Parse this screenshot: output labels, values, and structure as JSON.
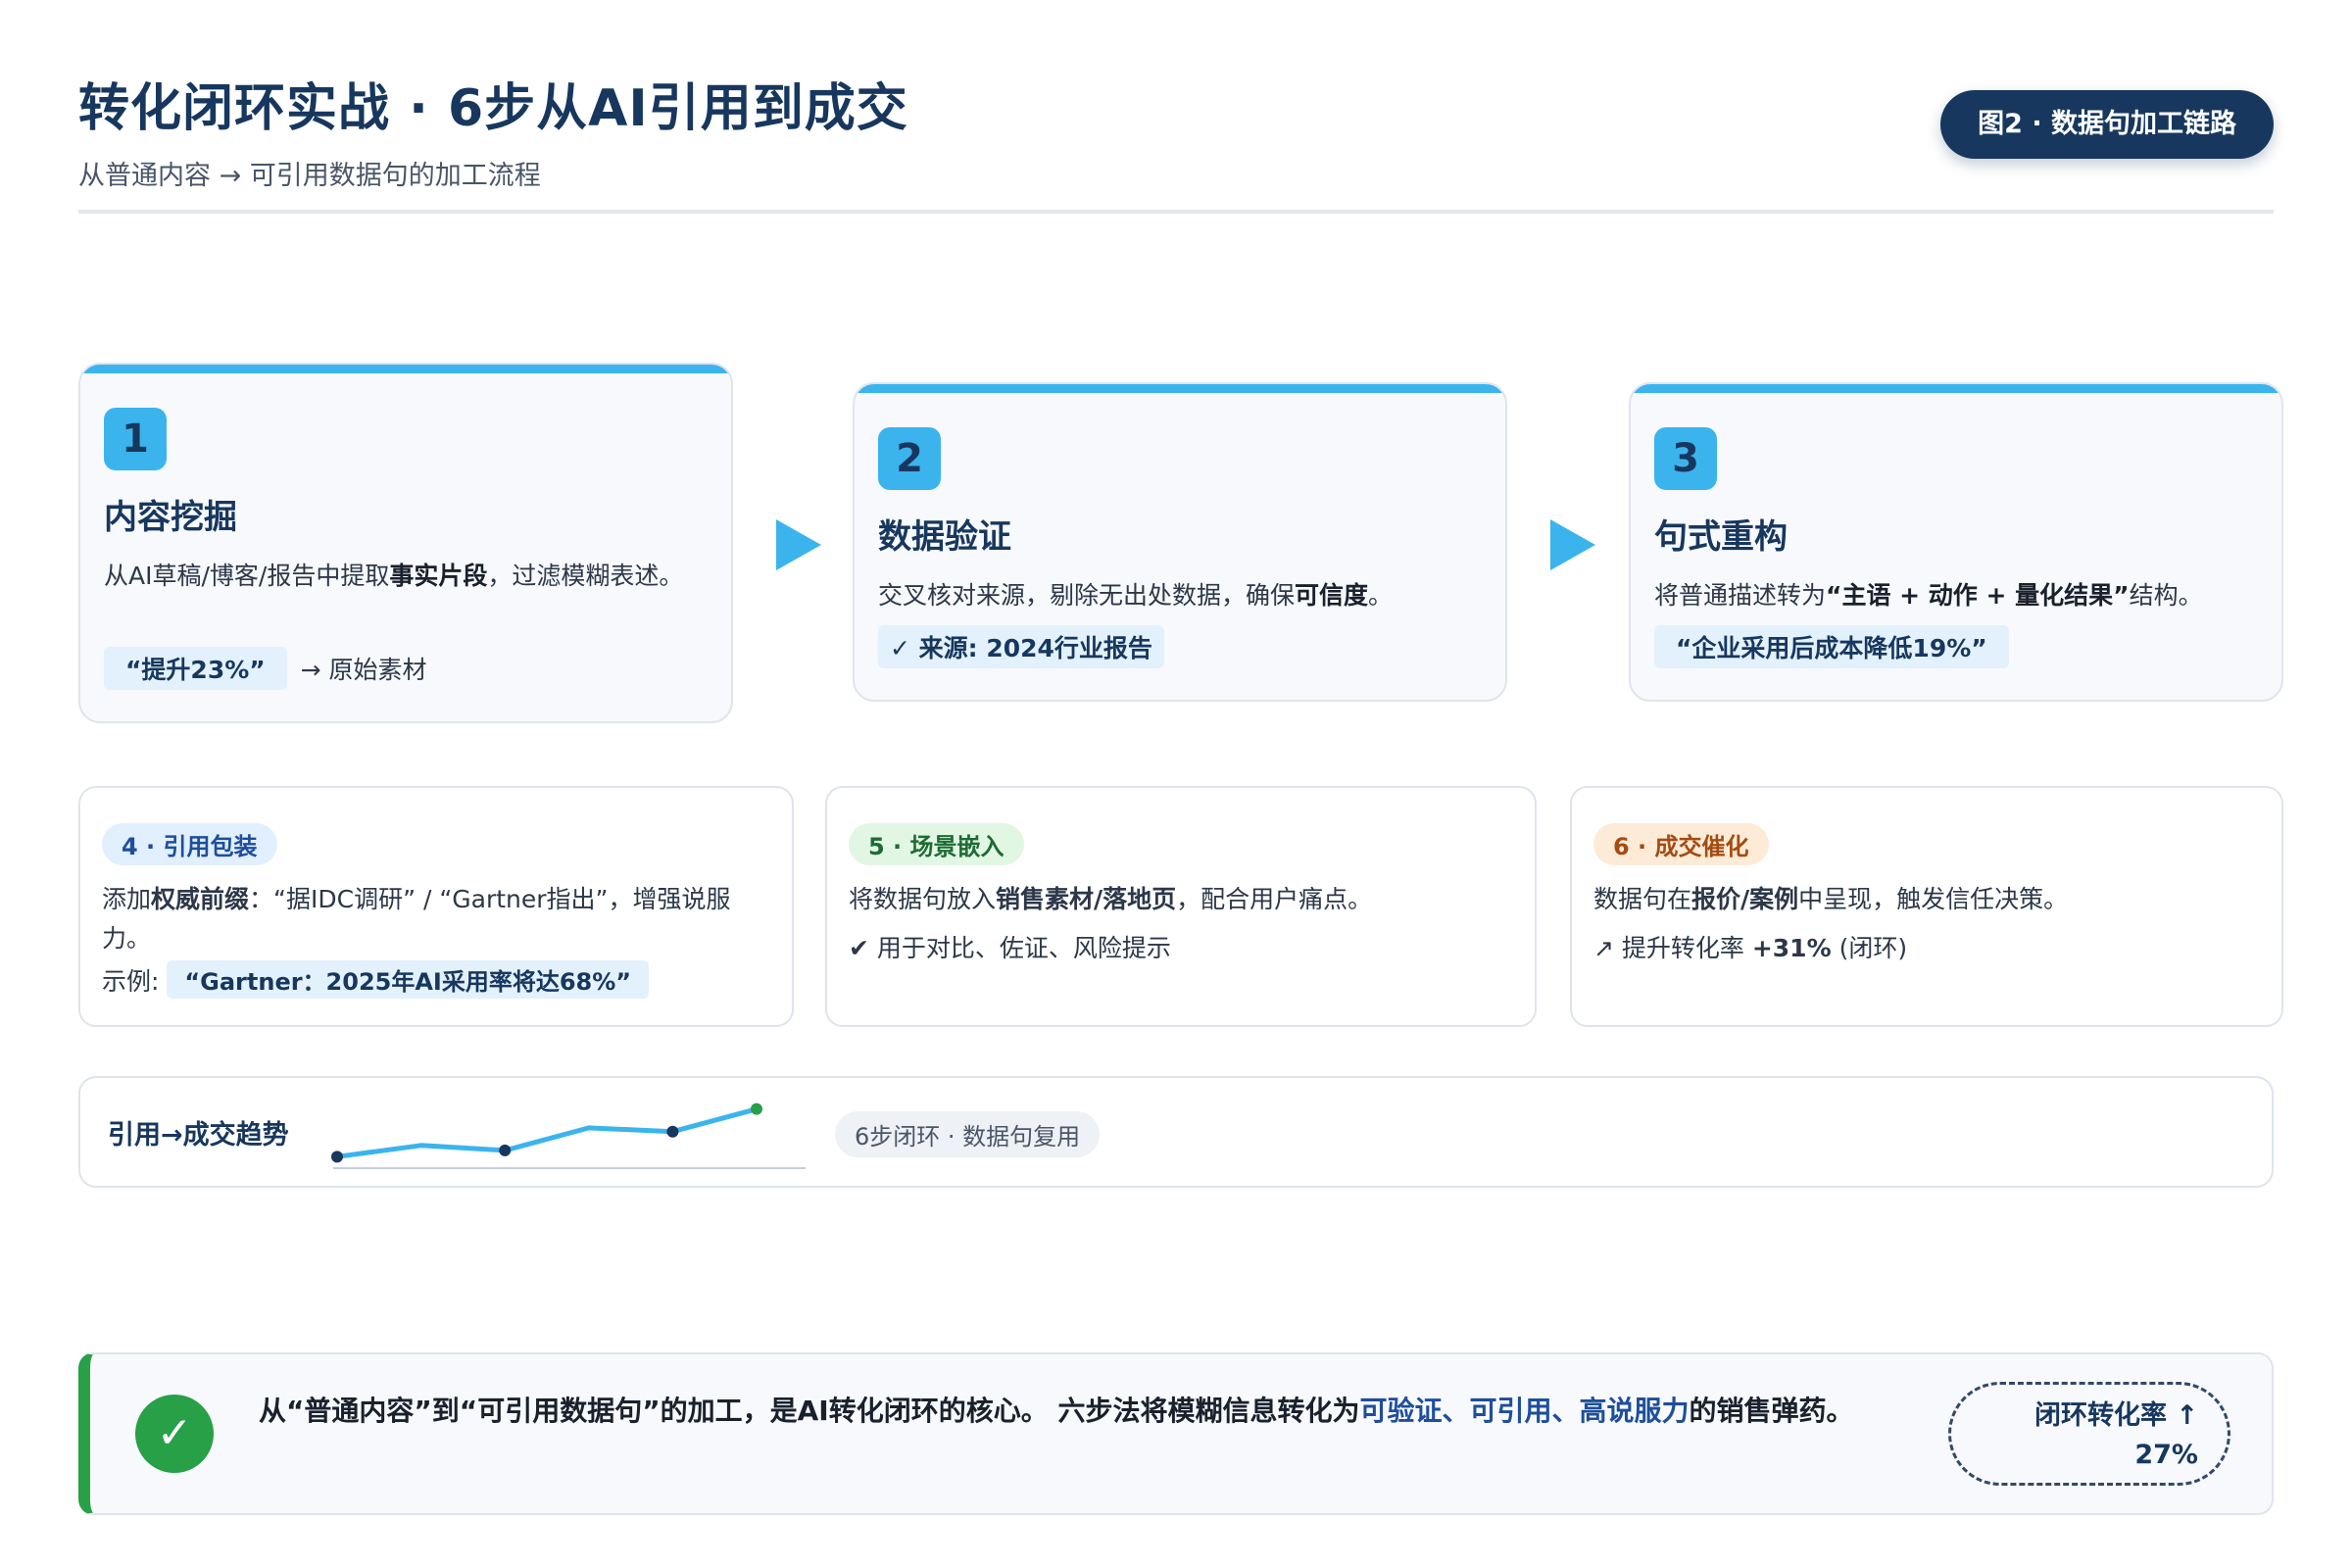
{
  "header": {
    "title": "转化闭环实战 · 6步从AI引用到成交",
    "subtitle": "从普通内容 → 可引用数据句的加工流程",
    "figure_badge": "图2 · 数据句加工链路"
  },
  "steps": [
    {
      "number": "1",
      "title": "内容挖掘",
      "desc_prefix": "从AI草稿/博客/报告中提取",
      "desc_bold": "事实片段",
      "desc_suffix": "，过滤模糊表述。",
      "chip": "“提升23%”",
      "chip_note": "→ 原始素材"
    },
    {
      "number": "2",
      "title": "数据验证",
      "desc_prefix": "交叉核对来源，剔除无出处数据，确保",
      "desc_bold": "可信度",
      "desc_suffix": "。",
      "chip": "✓ 来源: 2024行业报告"
    },
    {
      "number": "3",
      "title": "句式重构",
      "desc_prefix": "将普通描述转为",
      "desc_bold": "“主语 + 动作 + 量化结果”",
      "desc_suffix": "结构。",
      "chip": "“企业采用后成本降低19%”"
    }
  ],
  "mini_steps": [
    {
      "tag": "4 · 引用包装",
      "desc_prefix": "添加",
      "desc_bold": "权威前缀",
      "desc_suffix": "：“据IDC调研” / “Gartner指出”，增强说服力。",
      "example_label": "示例: ",
      "example_chip": "“Gartner：2025年AI采用率将达68%”"
    },
    {
      "tag": "5 · 场景嵌入",
      "desc_prefix": "将数据句放入",
      "desc_bold": "销售素材/落地页",
      "desc_suffix": "，配合用户痛点。",
      "line": "✔ 用于对比、佐证、风险提示"
    },
    {
      "tag": "6 · 成交催化",
      "desc_prefix": "数据句在",
      "desc_bold": "报价/案例",
      "desc_suffix": "中呈现，触发信任决策。",
      "line_prefix": "↗ 提升转化率 ",
      "line_bold": "+31%",
      "line_suffix": " (闭环)"
    }
  ],
  "trend": {
    "label": "引用→成交趋势",
    "pill": "6步闭环 · 数据句复用",
    "points": [
      0.12,
      0.3,
      0.22,
      0.58,
      0.52,
      0.88
    ],
    "line_color": "#3bb4ee",
    "dot_color": "#17375e",
    "last_dot_color": "#27a047"
  },
  "summary": {
    "part1": "从“普通内容”到“可引用数据句”的加工，是AI转化闭环的核心。 六步法将模糊信息转化为",
    "highlight": "可验证、可引用、高说服力",
    "part2": "的销售弹药。",
    "rate_label": "闭环转化率 ↑",
    "rate_value": "27%"
  }
}
